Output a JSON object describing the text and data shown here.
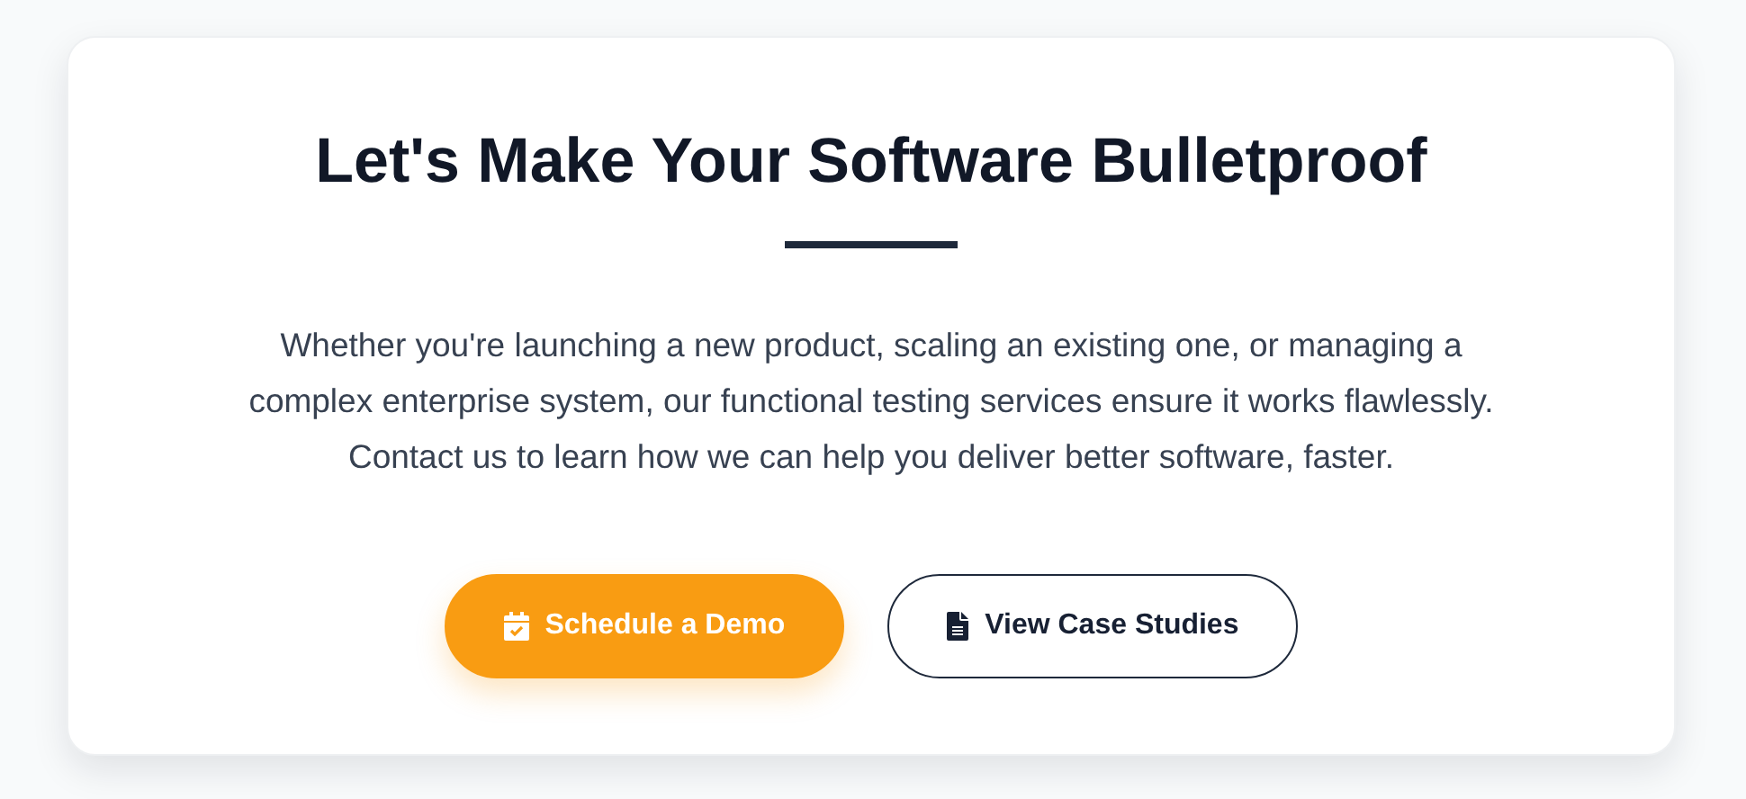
{
  "cta": {
    "title": "Let's Make Your Software Bulletproof",
    "text": "Whether you're launching a new product, scaling an existing one, or managing a complex enterprise system, our functional testing services ensure it works flawlessly. Contact us to learn how we can help you deliver better software, faster.",
    "buttons": [
      {
        "label": "Schedule a Demo",
        "kind": "primary"
      },
      {
        "label": "View Case Studies",
        "kind": "outline"
      }
    ]
  }
}
